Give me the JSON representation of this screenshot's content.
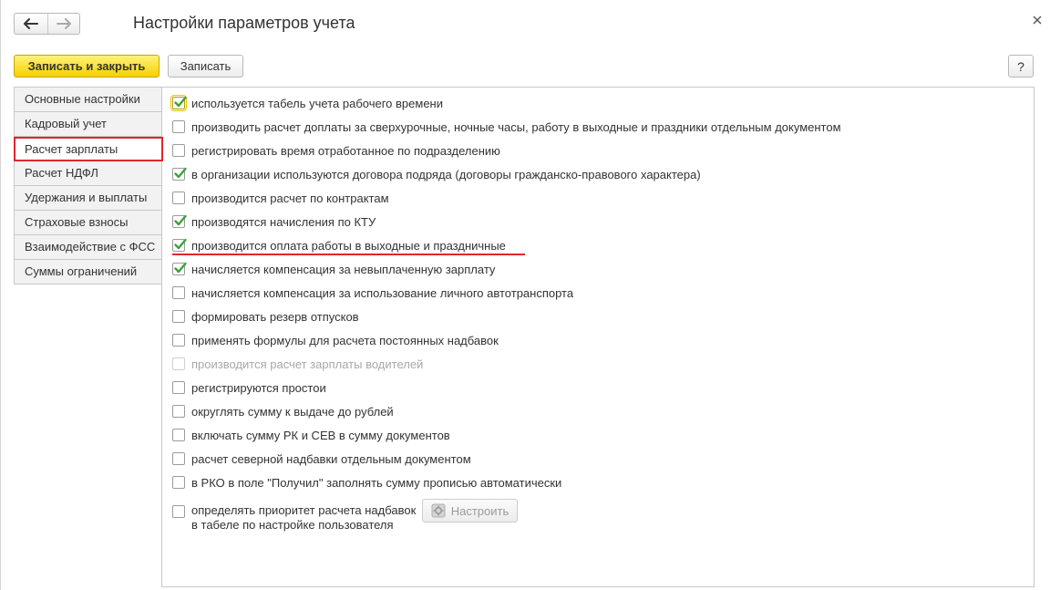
{
  "window": {
    "title": "Настройки параметров учета"
  },
  "nav": {
    "back_icon": "arrow-left-icon",
    "forward_icon": "arrow-right-icon"
  },
  "toolbar": {
    "save_close_label": "Записать и закрыть",
    "save_label": "Записать",
    "help_label": "?"
  },
  "sidebar": {
    "items": [
      {
        "label": "Основные настройки",
        "active": false
      },
      {
        "label": "Кадровый учет",
        "active": false
      },
      {
        "label": "Расчет зарплаты",
        "active": true
      },
      {
        "label": "Расчет НДФЛ",
        "active": false
      },
      {
        "label": "Удержания и выплаты",
        "active": false
      },
      {
        "label": "Страховые взносы",
        "active": false
      },
      {
        "label": "Взаимодействие с ФСС",
        "active": false
      },
      {
        "label": "Суммы ограничений",
        "active": false
      }
    ]
  },
  "options": [
    {
      "label": "используется табель учета рабочего времени",
      "checked": true,
      "disabled": false
    },
    {
      "label": "производить расчет доплаты за сверхурочные, ночные часы, работу в выходные и праздники отдельным документом",
      "checked": false,
      "disabled": false
    },
    {
      "label": "регистрировать время отработанное по подразделению",
      "checked": false,
      "disabled": false
    },
    {
      "label": "в организации используются договора подряда (договоры гражданско-правового характера)",
      "checked": true,
      "disabled": false
    },
    {
      "label": "производится расчет по контрактам",
      "checked": false,
      "disabled": false
    },
    {
      "label": "производятся начисления по КТУ",
      "checked": true,
      "disabled": false
    },
    {
      "label": "производится оплата работы в выходные и праздничные",
      "checked": true,
      "disabled": false
    },
    {
      "label": "начисляется компенсация за невыплаченную зарплату",
      "checked": true,
      "disabled": false
    },
    {
      "label": "начисляется компенсация за использование личного автотранспорта",
      "checked": false,
      "disabled": false
    },
    {
      "label": "формировать резерв отпусков",
      "checked": false,
      "disabled": false
    },
    {
      "label": "применять формулы для расчета постоянных надбавок",
      "checked": false,
      "disabled": false
    },
    {
      "label": "производится расчет зарплаты водителей",
      "checked": false,
      "disabled": true
    },
    {
      "label": "регистрируются простои",
      "checked": false,
      "disabled": false
    },
    {
      "label": "округлять сумму к выдаче до рублей",
      "checked": false,
      "disabled": false
    },
    {
      "label": "включать сумму РК и СЕВ в сумму документов",
      "checked": false,
      "disabled": false
    },
    {
      "label": "расчет северной надбавки отдельным документом",
      "checked": false,
      "disabled": false
    },
    {
      "label": "в РКО в поле \"Получил\" заполнять сумму прописью автоматически",
      "checked": false,
      "disabled": false
    }
  ],
  "last_option": {
    "label_line1": "определять приоритет расчета надбавок",
    "label_line2": "в табеле по настройке пользователя",
    "checked": false
  },
  "config_button": {
    "label": "Настроить",
    "icon": "settings-icon"
  },
  "colors": {
    "accent_yellow": "#f6d000",
    "highlight_red": "#e0262c",
    "check_green": "#3aa33a"
  }
}
